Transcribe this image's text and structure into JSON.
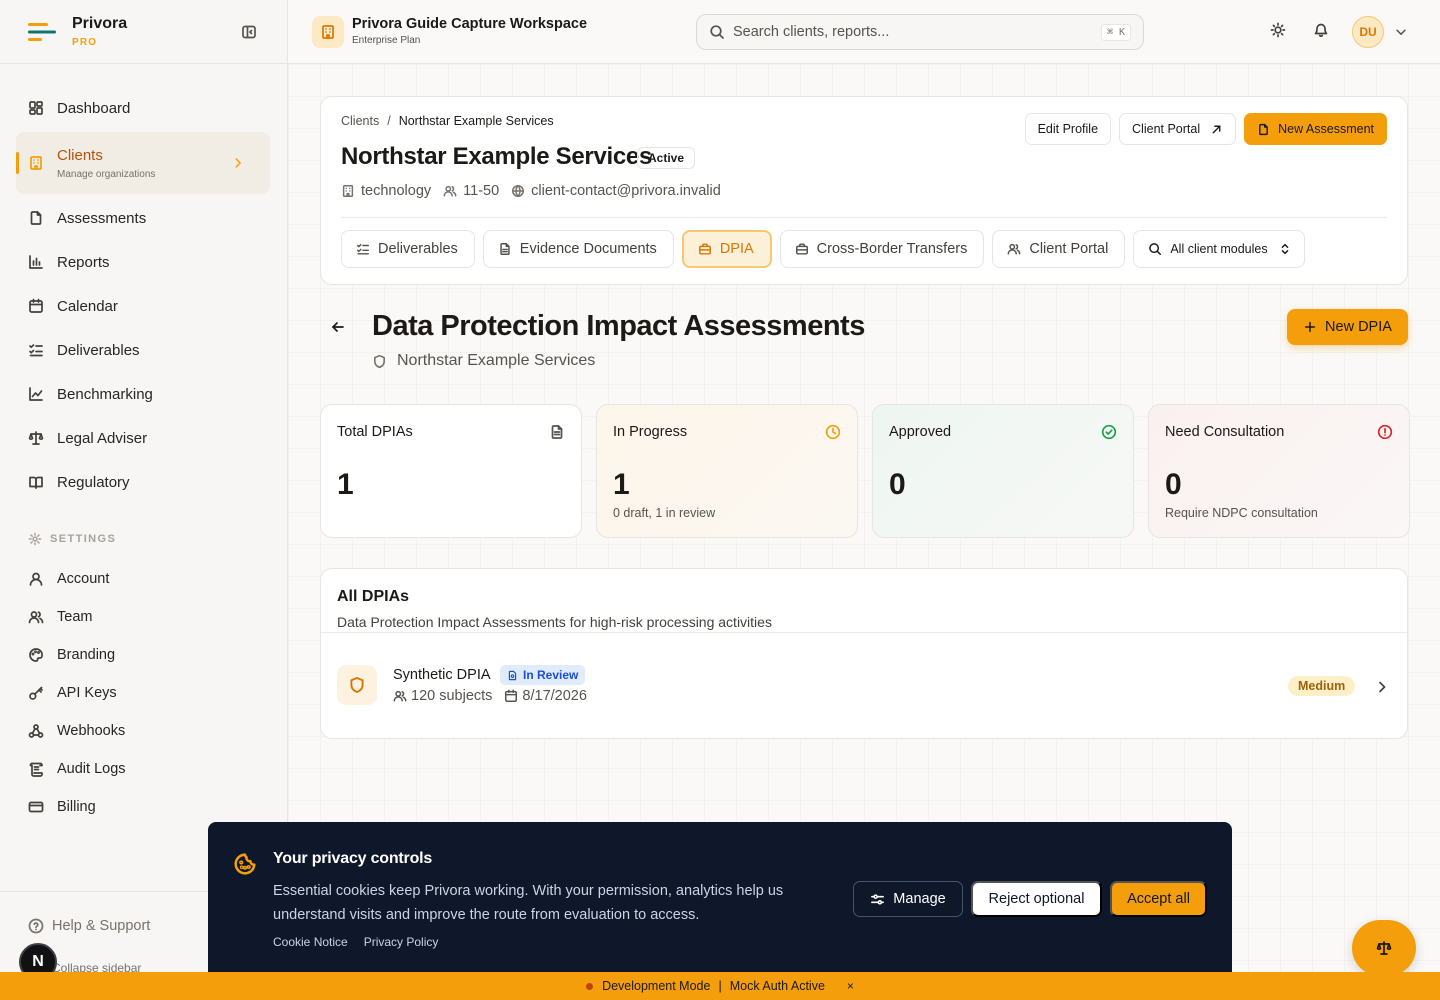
{
  "brand": {
    "name": "Privora",
    "tier": "PRO"
  },
  "sidebar": {
    "items": [
      {
        "label": "Dashboard",
        "icon": "dashboard-icon"
      },
      {
        "label": "Clients",
        "sub": "Manage organizations",
        "icon": "building-icon",
        "active": true
      },
      {
        "label": "Assessments",
        "icon": "file-icon"
      },
      {
        "label": "Reports",
        "icon": "bar-chart-icon"
      },
      {
        "label": "Calendar",
        "icon": "calendar-icon"
      },
      {
        "label": "Deliverables",
        "icon": "list-check-icon"
      },
      {
        "label": "Benchmarking",
        "icon": "line-chart-icon"
      },
      {
        "label": "Legal Adviser",
        "icon": "scale-icon"
      },
      {
        "label": "Regulatory",
        "icon": "book-icon"
      }
    ],
    "settings_label": "SETTINGS",
    "settings": [
      {
        "label": "Account",
        "icon": "user-icon"
      },
      {
        "label": "Team",
        "icon": "users-icon"
      },
      {
        "label": "Branding",
        "icon": "palette-icon"
      },
      {
        "label": "API Keys",
        "icon": "key-icon"
      },
      {
        "label": "Webhooks",
        "icon": "webhook-icon"
      },
      {
        "label": "Audit Logs",
        "icon": "scroll-icon"
      },
      {
        "label": "Billing",
        "icon": "credit-card-icon"
      }
    ],
    "help": "Help & Support",
    "collapse": "Collapse sidebar",
    "n_badge": "N"
  },
  "topbar": {
    "workspace_title": "Privora Guide Capture Workspace",
    "workspace_plan": "Enterprise Plan",
    "search_placeholder": "Search clients, reports...",
    "search_kbd": "⌘ K",
    "avatar": "DU"
  },
  "client": {
    "breadcrumb_root": "Clients",
    "breadcrumb_sep": "/",
    "breadcrumb_current": "Northstar Example Services",
    "name": "Northstar Example Services",
    "status": "Active",
    "industry": "technology",
    "size": "11-50",
    "email": "client-contact@privora.invalid",
    "actions": {
      "edit": "Edit Profile",
      "portal": "Client Portal",
      "new_assessment": "New Assessment"
    },
    "tabs": [
      {
        "label": "Deliverables",
        "icon": "list-check-icon"
      },
      {
        "label": "Evidence Documents",
        "icon": "file-icon"
      },
      {
        "label": "DPIA",
        "icon": "briefcase-icon",
        "active": true
      },
      {
        "label": "Cross-Border Transfers",
        "icon": "briefcase-icon"
      },
      {
        "label": "Client Portal",
        "icon": "users-icon"
      }
    ],
    "module_select": "All client modules"
  },
  "page": {
    "title": "Data Protection Impact Assessments",
    "subtitle": "Northstar Example Services",
    "new_button": "New DPIA"
  },
  "stats": [
    {
      "label": "Total DPIAs",
      "value": "1",
      "note": "",
      "icon": "file-text-icon",
      "color": "#57534e"
    },
    {
      "label": "In Progress",
      "value": "1",
      "note": "0 draft, 1 in review",
      "icon": "clock-icon",
      "color": "#f59e0b"
    },
    {
      "label": "Approved",
      "value": "0",
      "note": "",
      "icon": "check-circle-icon",
      "color": "#16a34a"
    },
    {
      "label": "Need Consultation",
      "value": "0",
      "note": "Require NDPC consultation",
      "icon": "alert-circle-icon",
      "color": "#dc2626"
    }
  ],
  "list": {
    "title": "All DPIAs",
    "description": "Data Protection Impact Assessments for high-risk processing activities",
    "rows": [
      {
        "name": "Synthetic DPIA",
        "status": "In Review",
        "subjects": "120 subjects",
        "date": "8/17/2026",
        "risk": "Medium"
      }
    ]
  },
  "cookie": {
    "title": "Your privacy controls",
    "text": "Essential cookies keep Privora working. With your permission, analytics help us understand visits and improve the route from evaluation to access.",
    "links": [
      "Cookie Notice",
      "Privacy Policy"
    ],
    "manage": "Manage",
    "reject": "Reject optional",
    "accept": "Accept all"
  },
  "devbar": {
    "mode": "Development Mode",
    "sep": "|",
    "auth": "Mock Auth Active",
    "close": "×"
  },
  "colors": {
    "accent": "#f59e0b",
    "dark": "#0f172a"
  }
}
